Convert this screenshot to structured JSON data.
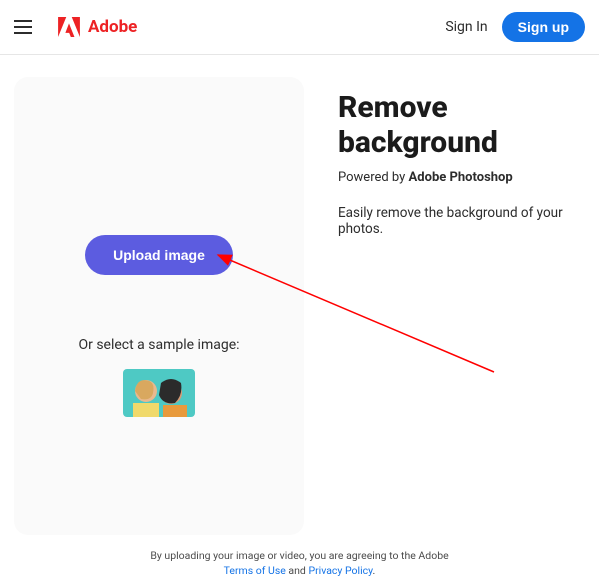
{
  "header": {
    "brand_name": "Adobe",
    "signin_label": "Sign In",
    "signup_label": "Sign up"
  },
  "panel": {
    "upload_label": "Upload image",
    "sample_label": "Or select a sample image:"
  },
  "hero": {
    "title": "Remove background",
    "powered_prefix": "Powered by ",
    "powered_strong": "Adobe Photoshop",
    "description": "Easily remove the background of your photos."
  },
  "legal": {
    "prefix": "By uploading your image or video, you are agreeing to the Adobe",
    "terms_label": "Terms of Use",
    "and": " and ",
    "privacy_label": "Privacy Policy",
    "suffix": "."
  },
  "colors": {
    "brand_red": "#ed2224",
    "primary_blue": "#1473e6",
    "action_purple": "#5c5ce0"
  }
}
